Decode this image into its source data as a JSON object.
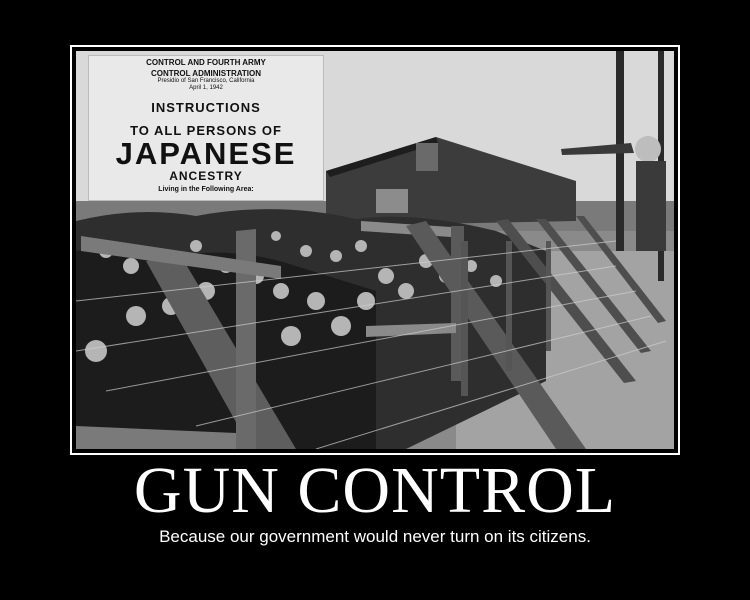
{
  "poster": {
    "title": "GUN CONTROL",
    "caption": "Because our government would never turn on its citizens."
  },
  "photo": {
    "description_label": "",
    "notice": {
      "header": "CONTROL AND FOURTH ARMY / CONTROL ADMINISTRATION",
      "header_line1": "CONTROL AND FOURTH ARMY",
      "header_line2": "CONTROL ADMINISTRATION",
      "location": "Presidio of San Francisco, California",
      "date": "April 1, 1942",
      "instructions_line1": "INSTRUCTIONS",
      "instructions_line2": "TO ALL PERSONS OF",
      "main": "JAPANESE",
      "ancestry": "ANCESTRY",
      "living": "Living in the Following Area:"
    }
  },
  "colors": {
    "background": "#000000",
    "frame": "#ffffff",
    "text": "#ffffff"
  }
}
